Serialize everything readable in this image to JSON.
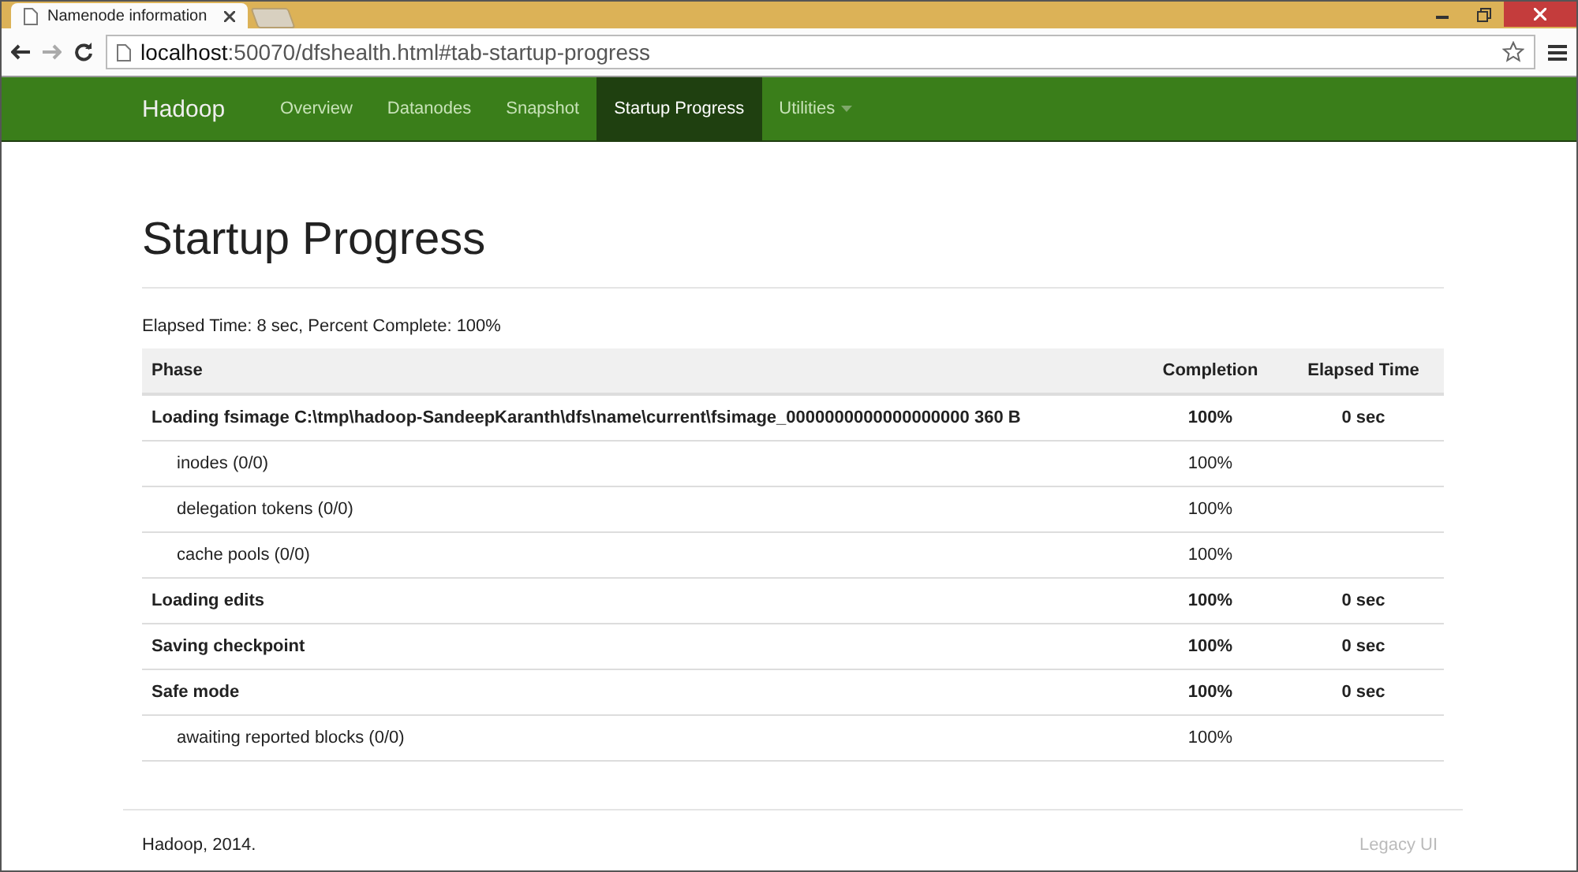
{
  "browser": {
    "tab_title": "Namenode information",
    "url_host": "localhost",
    "url_rest": ":50070/dfshealth.html#tab-startup-progress"
  },
  "navbar": {
    "brand": "Hadoop",
    "items": [
      {
        "label": "Overview",
        "selected": false,
        "dropdown": false
      },
      {
        "label": "Datanodes",
        "selected": false,
        "dropdown": false
      },
      {
        "label": "Snapshot",
        "selected": false,
        "dropdown": false
      },
      {
        "label": "Startup Progress",
        "selected": true,
        "dropdown": false
      },
      {
        "label": "Utilities",
        "selected": false,
        "dropdown": true
      }
    ]
  },
  "page": {
    "title": "Startup Progress",
    "summary": "Elapsed Time: 8 sec, Percent Complete: 100%"
  },
  "table": {
    "columns": [
      "Phase",
      "Completion",
      "Elapsed Time"
    ],
    "rows": [
      {
        "kind": "step",
        "phase": "Loading fsimage C:\\tmp\\hadoop-SandeepKaranth\\dfs\\name\\current\\fsimage_0000000000000000000 360 B",
        "completion": "100%",
        "elapsed": "0 sec"
      },
      {
        "kind": "substep",
        "phase": "inodes (0/0)",
        "completion": "100%"
      },
      {
        "kind": "substep",
        "phase": "delegation tokens (0/0)",
        "completion": "100%"
      },
      {
        "kind": "substep",
        "phase": "cache pools (0/0)",
        "completion": "100%"
      },
      {
        "kind": "step",
        "phase": "Loading edits",
        "completion": "100%",
        "elapsed": "0 sec"
      },
      {
        "kind": "step",
        "phase": "Saving checkpoint",
        "completion": "100%",
        "elapsed": "0 sec"
      },
      {
        "kind": "step",
        "phase": "Safe mode",
        "completion": "100%",
        "elapsed": "0 sec"
      },
      {
        "kind": "substep",
        "phase": "awaiting reported blocks (0/0)",
        "completion": "100%"
      }
    ]
  },
  "footer": {
    "copyright": "Hadoop, 2014.",
    "link": "Legacy UI"
  }
}
